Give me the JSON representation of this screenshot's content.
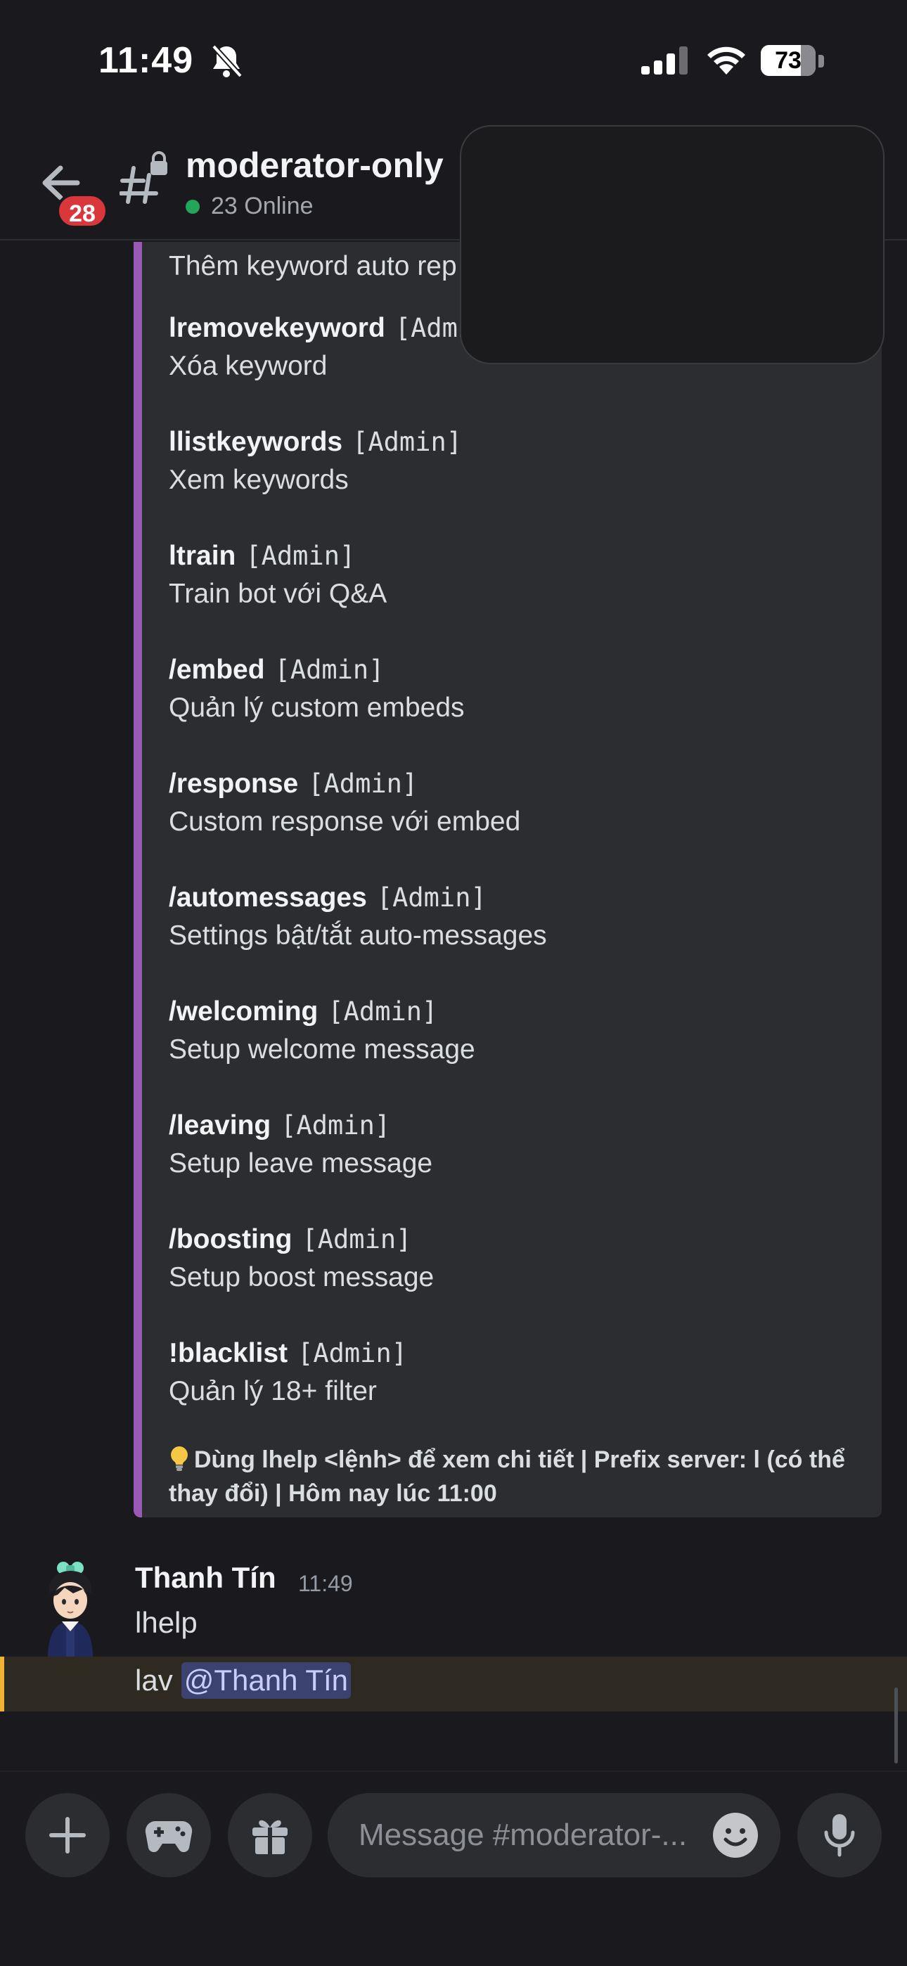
{
  "status_bar": {
    "time": "11:49",
    "battery_level": "73",
    "icons": [
      "bell-slash-icon",
      "cellular-signal-icon",
      "wifi-icon",
      "battery-icon"
    ]
  },
  "header": {
    "unread_badge": "28",
    "channel_name": "moderator-only",
    "online_status": "23 Online",
    "icons": [
      "back-arrow-icon",
      "locked-channel-hash-icon"
    ]
  },
  "embed": {
    "partial_top_line": "Thêm keyword auto rep",
    "commands": [
      {
        "name": "lremovekeyword",
        "tag": "[Admin]",
        "desc": "Xóa keyword"
      },
      {
        "name": "llistkeywords",
        "tag": "[Admin]",
        "desc": "Xem keywords"
      },
      {
        "name": "ltrain",
        "tag": "[Admin]",
        "desc": "Train bot với Q&A"
      },
      {
        "name": "/embed",
        "tag": "[Admin]",
        "desc": "Quản lý custom embeds"
      },
      {
        "name": "/response",
        "tag": "[Admin]",
        "desc": "Custom response với embed"
      },
      {
        "name": "/automessages",
        "tag": "[Admin]",
        "desc": "Settings bật/tắt auto-messages"
      },
      {
        "name": "/welcoming",
        "tag": "[Admin]",
        "desc": "Setup welcome message"
      },
      {
        "name": "/leaving",
        "tag": "[Admin]",
        "desc": "Setup leave message"
      },
      {
        "name": "/boosting",
        "tag": "[Admin]",
        "desc": "Setup boost message"
      },
      {
        "name": "!blacklist",
        "tag": "[Admin]",
        "desc": "Quản lý 18+ filter"
      }
    ],
    "footer_line1": "Dùng lhelp <lệnh> để xem chi tiết | Prefix server: l (có thể",
    "footer_line2": "thay đổi) | Hôm nay lúc 11:00",
    "accent_color": "#9b59b6"
  },
  "message": {
    "author": "Thanh Tín",
    "time": "11:49",
    "line1": "lhelp",
    "line2_text": "lav",
    "mention": "@Thanh Tín"
  },
  "composer": {
    "placeholder": "Message #moderator-...",
    "icons": [
      "plus-icon",
      "gamepad-icon",
      "gift-icon",
      "emoji-icon",
      "microphone-icon"
    ]
  }
}
